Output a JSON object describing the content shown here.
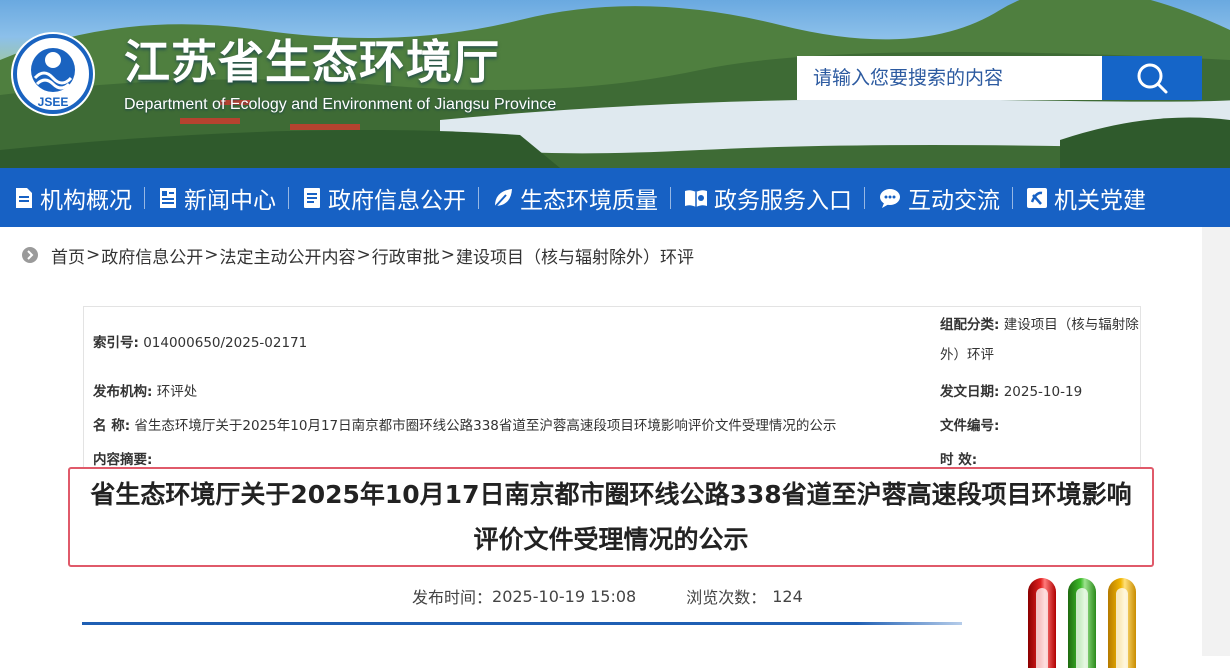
{
  "site": {
    "title": "江苏省生态环境厅",
    "subtitle": "Department of Ecology and Environment of Jiangsu Province",
    "logo_text": "JSEE"
  },
  "search": {
    "placeholder": "请输入您要搜索的内容",
    "icon": "search-icon"
  },
  "nav": {
    "items": [
      {
        "label": "机构概况",
        "icon": "document-icon"
      },
      {
        "label": "新闻中心",
        "icon": "newspaper-icon"
      },
      {
        "label": "政府信息公开",
        "icon": "info-file-icon"
      },
      {
        "label": "生态环境质量",
        "icon": "leaf-icon"
      },
      {
        "label": "政务服务入口",
        "icon": "open-book-icon"
      },
      {
        "label": "互动交流",
        "icon": "chat-bubble-icon"
      },
      {
        "label": "机关党建",
        "icon": "party-emblem-icon"
      }
    ],
    "color": "#1761c4"
  },
  "breadcrumb": {
    "items": [
      "首页",
      "政府信息公开",
      "法定主动公开内容",
      "行政审批",
      "建设项目（核与辐射除外）环评"
    ],
    "separator": ">"
  },
  "info": {
    "index": {
      "label": "索引号:",
      "value": "014000650/2025-02171"
    },
    "category": {
      "label": "组配分类:",
      "value": "建设项目（核与辐射除外）环评"
    },
    "publisher": {
      "label": "发布机构:",
      "value": "环评处"
    },
    "issue_date": {
      "label": "发文日期:",
      "value": "2025-10-19"
    },
    "name": {
      "label": "名 称:",
      "value": "省生态环境厅关于2025年10月17日南京都市圈环线公路338省道至沪蓉高速段项目环境影响评价文件受理情况的公示"
    },
    "doc_number": {
      "label": "文件编号:",
      "value": ""
    },
    "summary": {
      "label": "内容摘要:",
      "value": ""
    },
    "validity": {
      "label": "时 效:",
      "value": ""
    }
  },
  "article": {
    "title": "省生态环境厅关于2025年10月17日南京都市圈环线公路338省道至沪蓉高速段项目环境影响评价文件受理情况的公示",
    "publish_label": "发布时间：",
    "publish_time": "2025-10-19 15:08",
    "views_label": "浏览次数：",
    "views": "124",
    "highlight_color": "#e05a6a"
  }
}
